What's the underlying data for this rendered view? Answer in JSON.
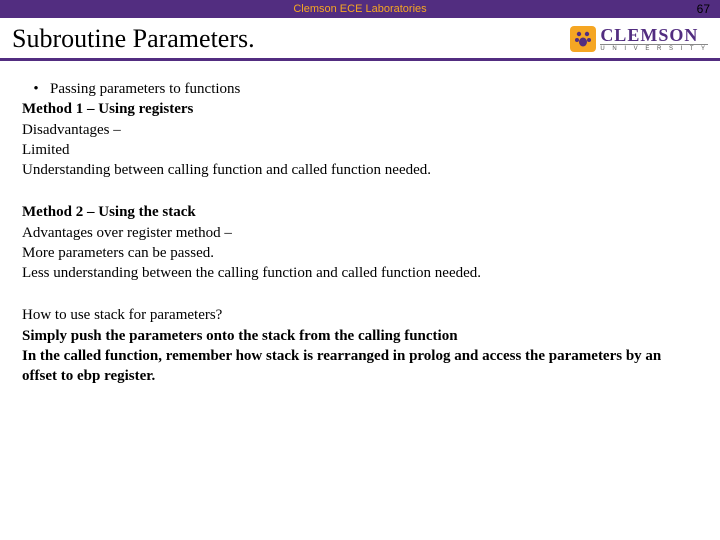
{
  "header": {
    "lab_label": "Clemson ECE Laboratories",
    "page_number": "67",
    "title": "Subroutine Parameters.",
    "logo_main": "CLEMSON",
    "logo_sub": "U N I V E R S I T Y"
  },
  "body": {
    "block1": {
      "bullet": "•",
      "l1": "Passing parameters to functions",
      "l2": "Method 1 – Using registers",
      "l3": "Disadvantages –",
      "l4": "Limited",
      "l5": "Understanding between calling function and called function needed."
    },
    "block2": {
      "l1": "Method 2 – Using the stack",
      "l2": "Advantages over register method –",
      "l3": "More parameters can be passed.",
      "l4": "Less understanding between the calling function and called function needed."
    },
    "block3": {
      "l1": "How to use stack for parameters?",
      "l2": "Simply push the parameters onto the stack from the calling function",
      "l3": "In the called function, remember how stack is rearranged in prolog and access the parameters by an offset to ebp register."
    }
  }
}
